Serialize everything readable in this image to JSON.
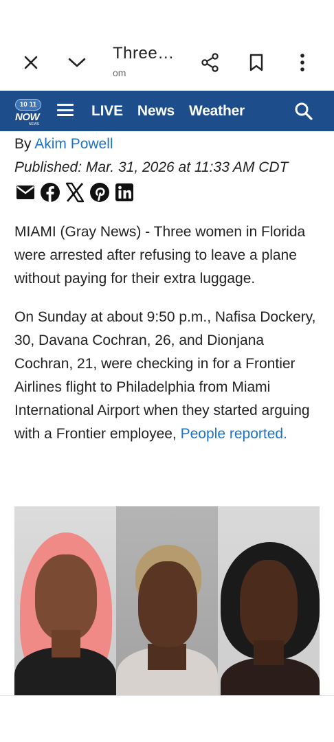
{
  "browser": {
    "title": "Three…",
    "url": "om",
    "icons": [
      "close-icon",
      "chevron-down-icon",
      "share-icon",
      "bookmark-icon",
      "more-vert-icon"
    ]
  },
  "site": {
    "logo": {
      "pill_text": "10 11",
      "brand": "NOW",
      "sub": "NEWS"
    },
    "nav": [
      {
        "label": "LIVE"
      },
      {
        "label": "News"
      },
      {
        "label": "Weather"
      }
    ],
    "colors": {
      "nav_bg": "#1d4d8a",
      "link": "#1a73c9"
    }
  },
  "article": {
    "by_prefix": "By",
    "author": "Akim Powell",
    "published": "Published: Mar. 31, 2026 at 11:33 AM CDT",
    "share_icons": [
      "email-icon",
      "facebook-icon",
      "x-icon",
      "pinterest-icon",
      "linkedin-icon"
    ],
    "para1": "MIAMI (Gray News) - Three women in Florida were arrested after refusing to leave a plane without paying for their extra luggage.",
    "para2": "On Sunday at about 9:50 p.m., Nafisa Dockery, 30, Davana Cochran, 26, and Dionjana Cochran, 21, were checking in for a Frontier Airlines flight to Philadelphia from Miami International Airport when they started arguing with a Frontier employee,",
    "para2_link": "People reported."
  }
}
